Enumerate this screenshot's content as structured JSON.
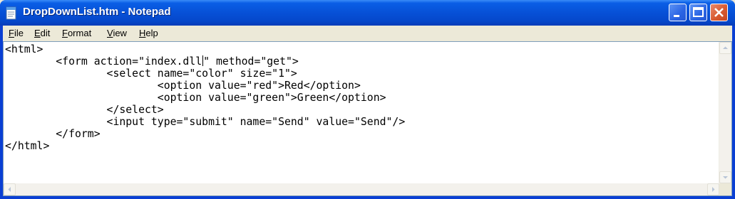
{
  "window": {
    "title": "DropDownList.htm - Notepad",
    "icons": {
      "app": "notepad-icon",
      "minimize": "minimize-icon",
      "maximize": "maximize-icon",
      "close": "close-icon"
    },
    "colors": {
      "titlebar": "#0a5ee6",
      "close_button": "#d85a30"
    }
  },
  "menu": [
    {
      "accel": "F",
      "rest": "ile"
    },
    {
      "accel": "E",
      "rest": "dit"
    },
    {
      "accel": "F",
      "rest": "ormat"
    },
    {
      "accel": "V",
      "rest": "iew"
    },
    {
      "accel": "H",
      "rest": "elp"
    }
  ],
  "editor": {
    "lines": [
      "<html>",
      "        <form action=\"index.dll",
      "                <select name=\"color\" size=\"1\">",
      "                        <option value=\"red\">Red</option>",
      "                        <option value=\"green\">Green</option>",
      "                </select>",
      "                <input type=\"submit\" name=\"Send\" value=\"Send\"/>",
      "        </form>",
      "</html>"
    ],
    "line2_after_caret": "\" method=\"get\">"
  }
}
